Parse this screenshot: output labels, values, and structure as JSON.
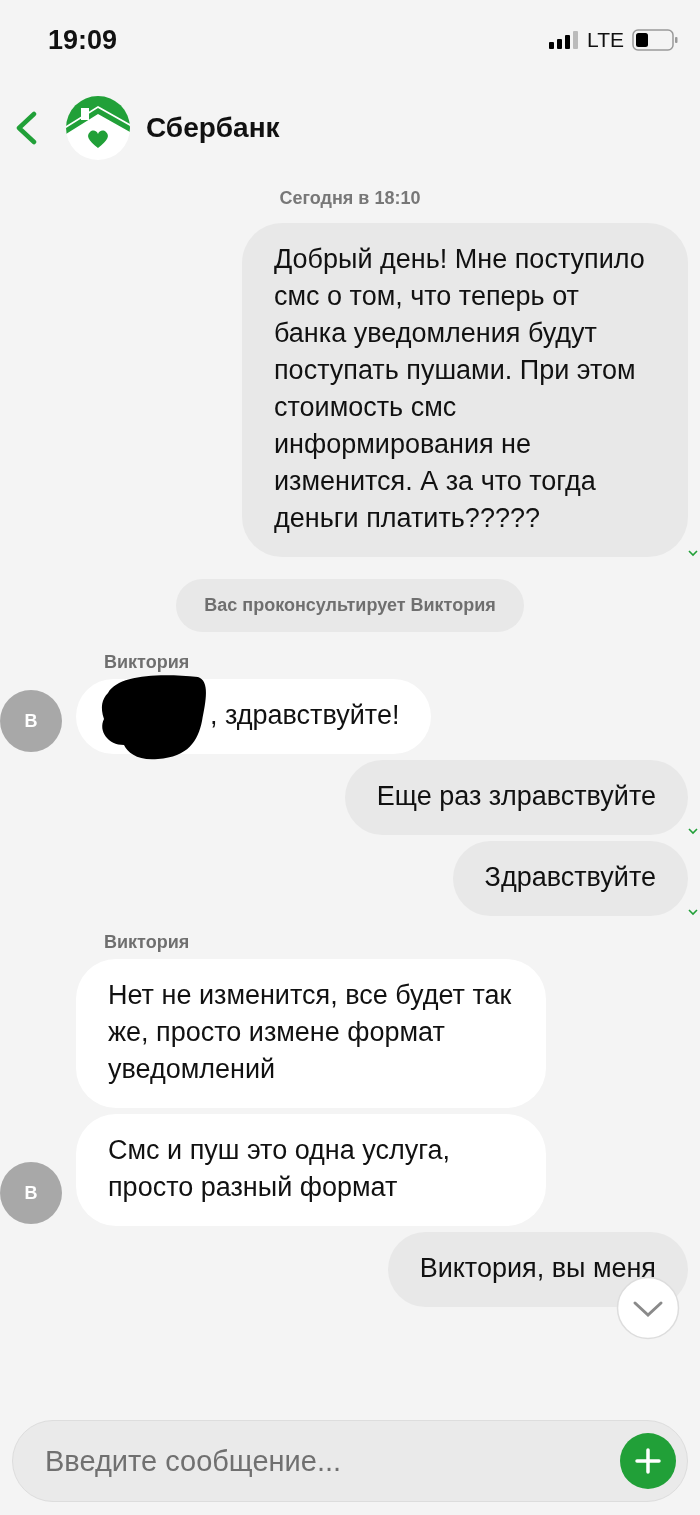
{
  "status_bar": {
    "time": "19:09",
    "network": "LTE"
  },
  "header": {
    "title": "Сбербанк"
  },
  "chat": {
    "date": "Сегодня в 18:10",
    "messages": [
      {
        "kind": "out",
        "text": "Добрый день! Мне поступило смс о том, что теперь от банка уведомления будут поступать пушами. При этом стоимость смс информирования не изменится. А за что тогда деньги платить?????",
        "delivered": true
      },
      {
        "kind": "system",
        "text": "Вас проконсультирует Виктория"
      },
      {
        "kind": "in",
        "sender": "Виктория",
        "text": ", здравствуйте!",
        "redacted": true,
        "avatar": "В"
      },
      {
        "kind": "out",
        "text": "Еще раз злравствуйте",
        "delivered": true
      },
      {
        "kind": "out",
        "text": "Здравствуйте",
        "delivered": true
      },
      {
        "kind": "in",
        "sender": "Виктория",
        "text": "Нет не изменится, все будет так же, просто измене формат уведомлений",
        "redacted": false
      },
      {
        "kind": "in",
        "text": "Смс и пуш это одна услуга, просто разный формат",
        "redacted": false,
        "avatar": "В"
      },
      {
        "kind": "out",
        "text": "Виктория, вы меня",
        "delivered": false
      }
    ]
  },
  "composer": {
    "placeholder": "Введите сообщение..."
  }
}
